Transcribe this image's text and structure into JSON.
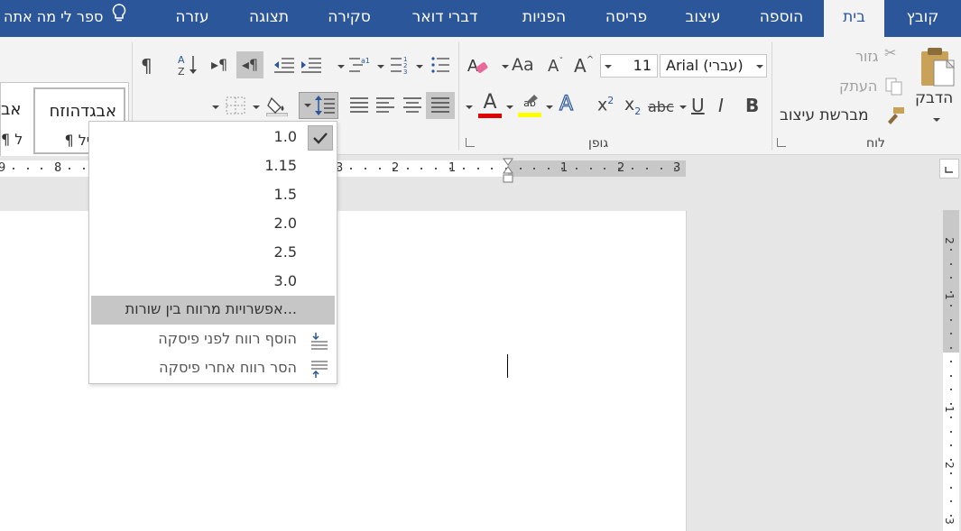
{
  "tabs": [
    {
      "label": "קובץ"
    },
    {
      "label": "בית"
    },
    {
      "label": "הוספה"
    },
    {
      "label": "עיצוב"
    },
    {
      "label": "פריסה"
    },
    {
      "label": "הפניות"
    },
    {
      "label": "דברי דואר"
    },
    {
      "label": "סקירה"
    },
    {
      "label": "תצוגה"
    },
    {
      "label": "עזרה"
    }
  ],
  "tell_me": "ספר לי מה אתה",
  "clipboard": {
    "paste": "הדבק",
    "cut": "גזור",
    "copy": "העתק",
    "format_painter": "מברשת עיצוב",
    "group_label": "לוח"
  },
  "font": {
    "font_name": "Arial (עברי)",
    "font_size": "11",
    "grow": "A",
    "shrink": "A",
    "change_case": "Aa",
    "bold": "B",
    "italic": "I",
    "underline": "U",
    "strikethrough": "abc",
    "subscript": "x",
    "subscript_mark": "2",
    "superscript": "x",
    "superscript_mark": "2",
    "text_effects": "A",
    "highlight_mark": "ab",
    "font_color": "A",
    "group_label": "גופן",
    "font_color_hex": "#e00000",
    "highlight_hex": "#ffff00"
  },
  "styles": {
    "preview_text": "אבגדהוזח",
    "style_name": "¶ רגיל",
    "cut_preview": "אב",
    "cut_name": "¶ ל"
  },
  "ruler": {
    "left_numbers": [
      "9",
      "8"
    ],
    "mid_numbers": [
      "3",
      "2",
      "1"
    ],
    "right_numbers": [
      "1",
      "2",
      "3"
    ]
  },
  "vruler": {
    "numbers": [
      "2",
      "1",
      "1",
      "2",
      "3"
    ]
  },
  "line_spacing_menu": {
    "values": [
      "1.0",
      "1.15",
      "1.5",
      "2.0",
      "2.5",
      "3.0"
    ],
    "selected": "1.0",
    "options_label": "אפשרויות מרווח בין שורות...",
    "add_space_before": "הוסף רווח לפני פיסקה",
    "remove_space_after": "הסר רווח אחרי פיסקה"
  }
}
